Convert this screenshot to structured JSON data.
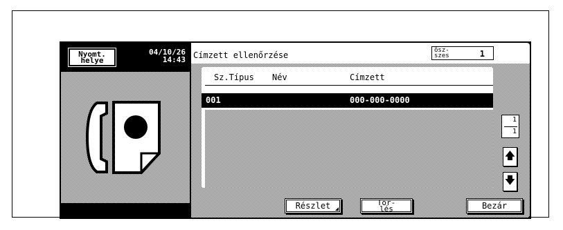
{
  "left": {
    "print_button_line1": "Nyomt.",
    "print_button_line2": "helye",
    "date": "04/10/26",
    "time": "14:43",
    "fax_icon": "fax-machine-icon"
  },
  "header": {
    "title": "Címzett ellenőrzése",
    "total_label_line1": "ösz-",
    "total_label_line2": "szes",
    "total_value": "1"
  },
  "list": {
    "columns": {
      "number_type": "Sz.Típus",
      "name": "Név",
      "recipient": "Címzett"
    },
    "rows": [
      {
        "number": "001",
        "name": "",
        "recipient": "000-000-0000"
      }
    ],
    "page_current": "1",
    "page_total": "1",
    "up_icon": "arrow-up-icon",
    "down_icon": "arrow-down-icon"
  },
  "buttons": {
    "details": "Részlet",
    "delete_line1": "Tör-",
    "delete_line2": "lés",
    "close": "Bezár"
  }
}
